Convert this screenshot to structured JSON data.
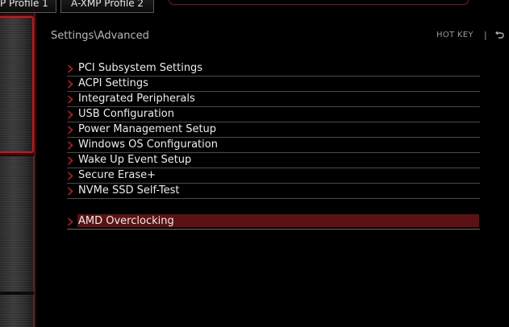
{
  "profile_tabs": [
    {
      "label": "P Profile 1"
    },
    {
      "label": "A-XMP Profile 2"
    }
  ],
  "header": {
    "breadcrumb": "Settings\\Advanced",
    "hotkey_label": "HOT KEY",
    "separator": "|"
  },
  "menu": {
    "items": [
      {
        "label": "PCI Subsystem Settings"
      },
      {
        "label": "ACPI Settings"
      },
      {
        "label": "Integrated Peripherals"
      },
      {
        "label": "USB Configuration"
      },
      {
        "label": "Power Management Setup"
      },
      {
        "label": "Windows OS Configuration"
      },
      {
        "label": "Wake Up Event Setup"
      },
      {
        "label": "Secure Erase+"
      },
      {
        "label": "NVMe SSD Self-Test"
      }
    ],
    "selected_item": {
      "label": "AMD Overclocking"
    }
  },
  "colors": {
    "accent_red": "#c8141c",
    "selection_bg": "#5c1212",
    "text": "#ececec",
    "background": "#000000"
  },
  "icons": {
    "menu_item": "chevron-right-icon",
    "back": "back-arrow-icon"
  }
}
